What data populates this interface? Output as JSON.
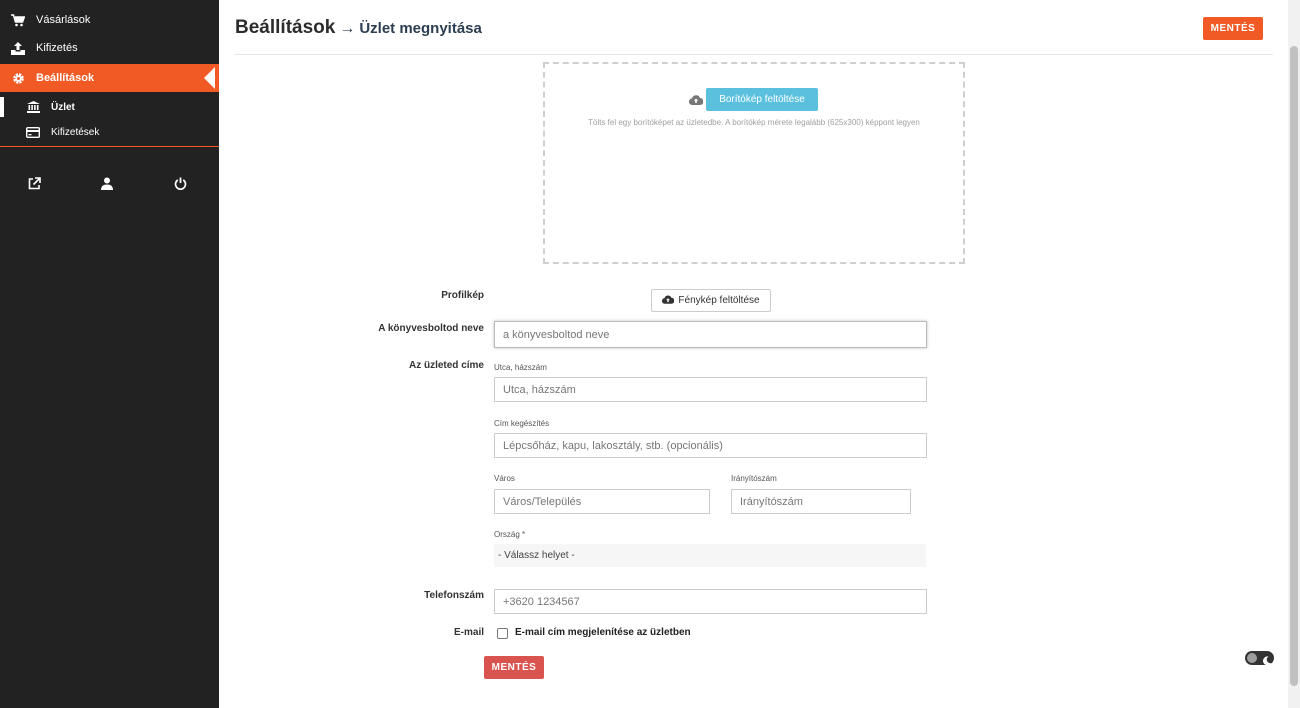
{
  "sidebar": {
    "items": [
      {
        "label": "Vásárlások",
        "icon": "cart-icon"
      },
      {
        "label": "Kifizetés",
        "icon": "upload-icon"
      },
      {
        "label": "Beállítások",
        "icon": "gear-icon",
        "active": true
      }
    ],
    "subitems": [
      {
        "label": "Üzlet",
        "icon": "bank-icon",
        "current": true
      },
      {
        "label": "Kifizetések",
        "icon": "credit-card-icon"
      }
    ],
    "footer_icons": [
      "external-link-icon",
      "user-icon",
      "power-icon"
    ],
    "accent_color": "#f15a24"
  },
  "header": {
    "title": "Beállítások",
    "arrow": "→",
    "subtitle": "Üzlet megnyitása",
    "save_label": "MENTÉS"
  },
  "cover": {
    "button_label": "Borítókép feltöltése",
    "help_text": "Tölts fel egy borítóképet az üzletedbe. A borítókép mérete legalább (625x300) képpont legyen"
  },
  "form": {
    "profile_label": "Profilkép",
    "photo_button_label": "Fénykép feltöltése",
    "store_name_label": "A könyvesboltod neve",
    "store_name_placeholder": "a könyvesboltod neve",
    "address_label": "Az üzleted címe",
    "street_label": "Utca, házszám",
    "street_placeholder": "Utca, házszám",
    "address2_label": "Cím kegészítés",
    "address2_placeholder": "Lépcsőház, kapu, lakosztály, stb. (opcionális)",
    "city_label": "Város",
    "city_placeholder": "Város/Település",
    "zip_label": "Irányítószám",
    "zip_placeholder": "Irányítószám",
    "country_label": "Ország *",
    "country_value": "- Válassz helyet -",
    "phone_label": "Telefonszám",
    "phone_placeholder": "+3620 1234567",
    "email_label": "E-mail",
    "email_checkbox_label": "E-mail cím megjelenítése az üzletben",
    "save_label": "MENTÉS",
    "save_color": "#d9534f"
  }
}
